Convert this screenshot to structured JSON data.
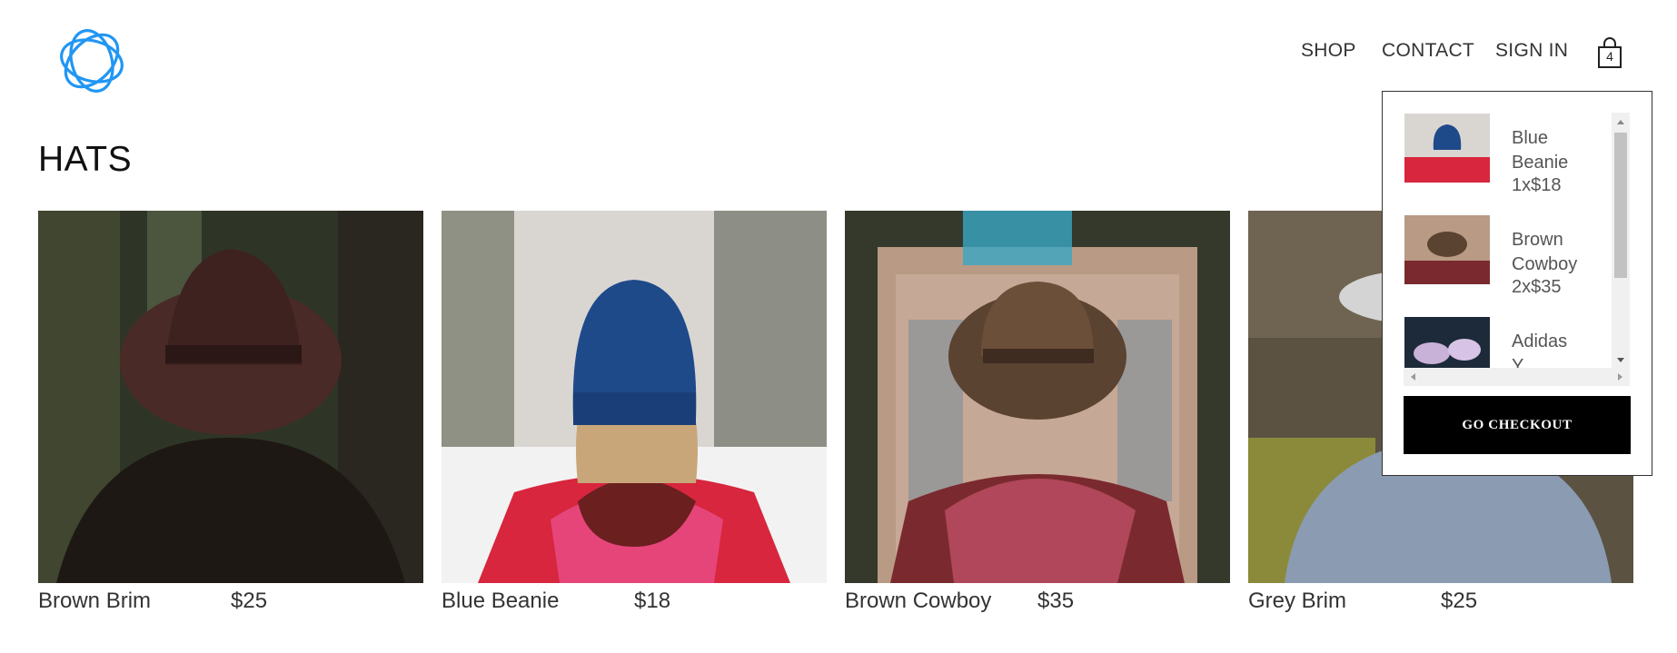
{
  "header": {
    "logo": "crown-logo-icon",
    "nav": {
      "shop": "SHOP",
      "contact": "CONTACT",
      "sign_in": "SIGN IN"
    },
    "cart": {
      "icon": "shopping-bag-icon",
      "count": "4"
    }
  },
  "page": {
    "title": "HATS"
  },
  "products": [
    {
      "name": "Brown Brim",
      "price": "$25"
    },
    {
      "name": "Blue Beanie",
      "price": "$18"
    },
    {
      "name": "Brown Cowboy",
      "price": "$35"
    },
    {
      "name": "Grey Brim",
      "price": "$25"
    }
  ],
  "cart_dropdown": {
    "items": [
      {
        "name": "Blue Beanie",
        "qty_price": "1x$18"
      },
      {
        "name": "Brown Cowboy",
        "qty_price": "2x$35"
      },
      {
        "name": "Adidas Y...",
        "qty_price": ""
      }
    ],
    "checkout_label": "GO CHECKOUT"
  },
  "colors": {
    "accent": "#2196f3",
    "button_bg": "#000000"
  }
}
